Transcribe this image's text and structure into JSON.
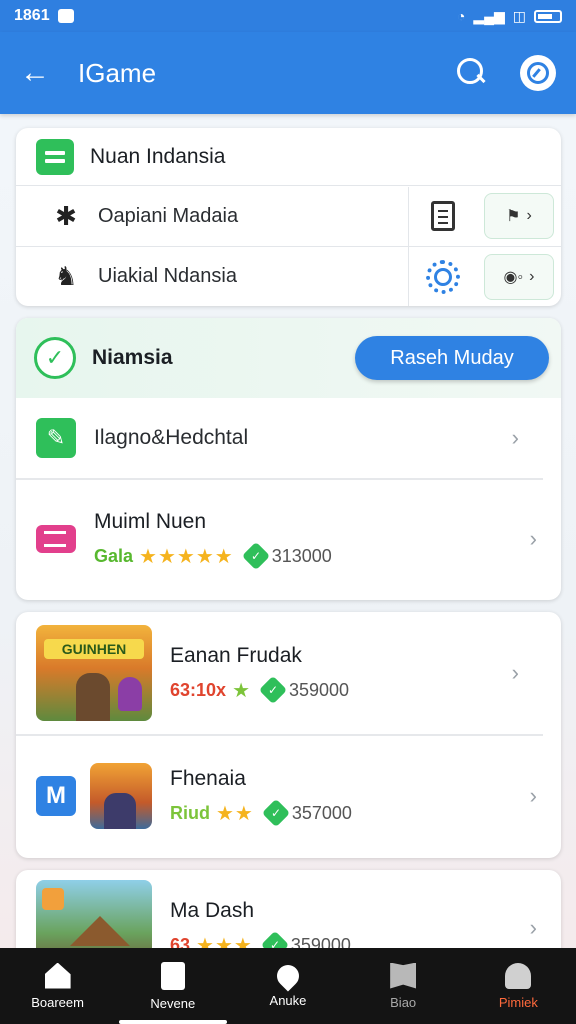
{
  "status": {
    "time": "1861"
  },
  "appbar": {
    "title": "IGame"
  },
  "card1": {
    "title": "Nuan Indansia",
    "rows": [
      {
        "label": "Oapiani Madaia"
      },
      {
        "label": "Uiakial Ndansia"
      }
    ]
  },
  "card2": {
    "title": "Niamsia",
    "button": "Raseh Muday",
    "row1": {
      "label": "Ilagno&Hedchtal"
    },
    "row2": {
      "name": "Muiml Nuen",
      "tagline": "Gala",
      "stars": "★★★★★",
      "count": "313000"
    }
  },
  "card3": {
    "game1": {
      "name": "Eanan Frudak",
      "tagline": "63:10x",
      "stars": "★",
      "count": "359000",
      "logo": "GUINHEN"
    },
    "game2": {
      "name": "Fhenaia",
      "tagline": "Riud",
      "stars": "★★",
      "count": "357000",
      "badge": "M"
    }
  },
  "card4": {
    "game3": {
      "name": "Ma Dash",
      "tagline": "63",
      "stars": "★★★",
      "count": "359000"
    }
  },
  "nav": {
    "items": [
      "Boareem",
      "Nevene",
      "Anuke",
      "Biao",
      "Pimiek"
    ]
  },
  "colors": {
    "primary": "#2f82e3",
    "accent_green": "#2fbf5a",
    "active_nav": "#ff6a3c"
  }
}
